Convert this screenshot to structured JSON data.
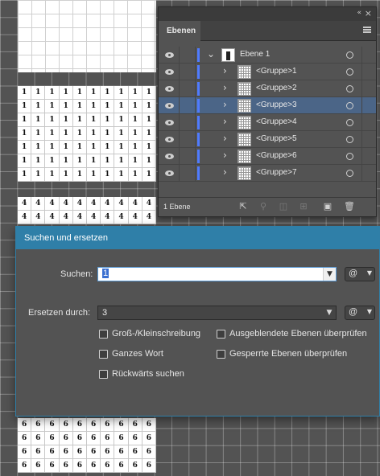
{
  "artboards": {
    "row1_digit": "1",
    "row4_digit": "4",
    "row6_digit": "6"
  },
  "layers_panel": {
    "tab": "Ebenen",
    "collapse_glyph": "«",
    "close_glyph": "×",
    "layers": [
      {
        "name": "Ebene 1",
        "level": 0,
        "expanded": true,
        "selected": false
      },
      {
        "name": "<Gruppe>1",
        "level": 1,
        "expanded": false,
        "selected": false
      },
      {
        "name": "<Gruppe>2",
        "level": 1,
        "expanded": false,
        "selected": false
      },
      {
        "name": "<Gruppe>3",
        "level": 1,
        "expanded": false,
        "selected": true
      },
      {
        "name": "<Gruppe>4",
        "level": 1,
        "expanded": false,
        "selected": false
      },
      {
        "name": "<Gruppe>5",
        "level": 1,
        "expanded": false,
        "selected": false
      },
      {
        "name": "<Gruppe>6",
        "level": 1,
        "expanded": false,
        "selected": false
      },
      {
        "name": "<Gruppe>7",
        "level": 1,
        "expanded": false,
        "selected": false
      }
    ],
    "layer_count": "1 Ebene",
    "accent_color": "#4f7bff",
    "footer_icons": [
      "export-icon",
      "search-icon",
      "clipping-mask-icon",
      "sublayer-icon",
      "new-layer-icon",
      "trash-icon"
    ]
  },
  "dialog": {
    "title": "Suchen und ersetzen",
    "search_label": "Suchen:",
    "search_value": "1",
    "replace_label": "Ersetzen durch:",
    "replace_value": "3",
    "at_symbol": "@",
    "checkboxes_left": [
      {
        "label": "Groß-/Kleinschreibung",
        "checked": false
      },
      {
        "label": "Ganzes Wort",
        "checked": false
      },
      {
        "label": "Rückwärts suchen",
        "checked": false
      }
    ],
    "checkboxes_right": [
      {
        "label": "Ausgeblendete Ebenen überprüfen",
        "checked": false
      },
      {
        "label": "Gesperrte Ebenen überprüfen",
        "checked": false
      }
    ],
    "title_bar_color": "#2f7fa8"
  }
}
